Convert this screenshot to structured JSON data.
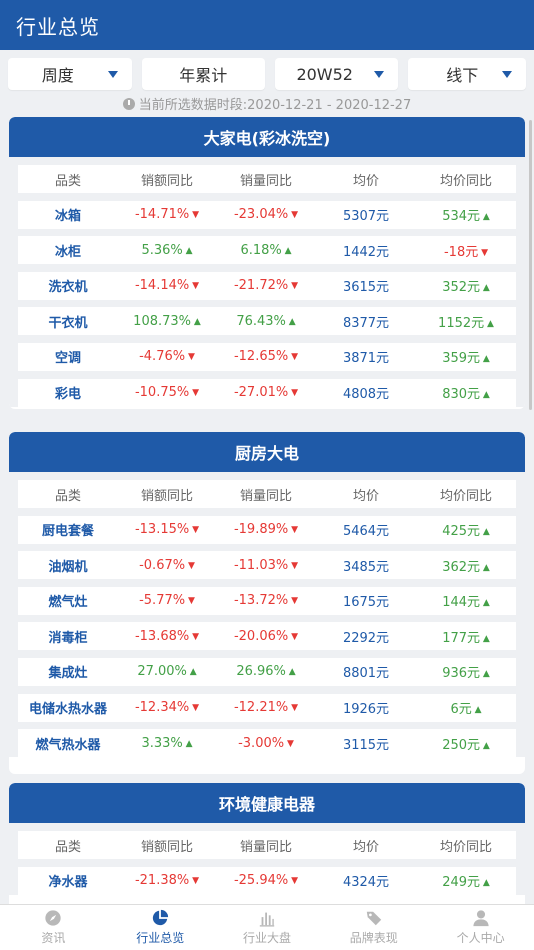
{
  "header": {
    "title": "行业总览"
  },
  "filters": [
    {
      "label": "周度",
      "has_dropdown": true
    },
    {
      "label": "年累计",
      "has_dropdown": false
    },
    {
      "label": "20W52",
      "has_dropdown": true
    },
    {
      "label": "线下",
      "has_dropdown": true
    }
  ],
  "period": {
    "text": "当前所选数据时段:2020-12-21 - 2020-12-27"
  },
  "columns": [
    "品类",
    "销额同比",
    "销量同比",
    "均价",
    "均价同比"
  ],
  "sections": [
    {
      "title": "大家电(彩冰洗空)",
      "rows": [
        {
          "name": "冰箱",
          "sales": "-14.71%",
          "volume": "-23.04%",
          "price": "5307元",
          "price_yoy": "534元"
        },
        {
          "name": "冰柜",
          "sales": "5.36%",
          "volume": "6.18%",
          "price": "1442元",
          "price_yoy": "-18元"
        },
        {
          "name": "洗衣机",
          "sales": "-14.14%",
          "volume": "-21.72%",
          "price": "3615元",
          "price_yoy": "352元"
        },
        {
          "name": "干衣机",
          "sales": "108.73%",
          "volume": "76.43%",
          "price": "8377元",
          "price_yoy": "1152元"
        },
        {
          "name": "空调",
          "sales": "-4.76%",
          "volume": "-12.65%",
          "price": "3871元",
          "price_yoy": "359元"
        },
        {
          "name": "彩电",
          "sales": "-10.75%",
          "volume": "-27.01%",
          "price": "4808元",
          "price_yoy": "830元"
        }
      ]
    },
    {
      "title": "厨房大电",
      "rows": [
        {
          "name": "厨电套餐",
          "sales": "-13.15%",
          "volume": "-19.89%",
          "price": "5464元",
          "price_yoy": "425元"
        },
        {
          "name": "油烟机",
          "sales": "-0.67%",
          "volume": "-11.03%",
          "price": "3485元",
          "price_yoy": "362元"
        },
        {
          "name": "燃气灶",
          "sales": "-5.77%",
          "volume": "-13.72%",
          "price": "1675元",
          "price_yoy": "144元"
        },
        {
          "name": "消毒柜",
          "sales": "-13.68%",
          "volume": "-20.06%",
          "price": "2292元",
          "price_yoy": "177元"
        },
        {
          "name": "集成灶",
          "sales": "27.00%",
          "volume": "26.96%",
          "price": "8801元",
          "price_yoy": "936元"
        },
        {
          "name": "电储水热水器",
          "sales": "-12.34%",
          "volume": "-12.21%",
          "price": "1926元",
          "price_yoy": "6元"
        },
        {
          "name": "燃气热水器",
          "sales": "3.33%",
          "volume": "-3.00%",
          "price": "3115元",
          "price_yoy": "250元"
        }
      ]
    },
    {
      "title": "环境健康电器",
      "rows": [
        {
          "name": "净水器",
          "sales": "-21.38%",
          "volume": "-25.94%",
          "price": "4324元",
          "price_yoy": "249元"
        }
      ]
    }
  ],
  "tabs": [
    {
      "label": "资讯",
      "icon": "compass-icon",
      "active": false
    },
    {
      "label": "行业总览",
      "icon": "pie-chart-icon",
      "active": true
    },
    {
      "label": "行业大盘",
      "icon": "bar-chart-icon",
      "active": false
    },
    {
      "label": "品牌表现",
      "icon": "tag-icon",
      "active": false
    },
    {
      "label": "个人中心",
      "icon": "user-icon",
      "active": false
    }
  ],
  "colors": {
    "primary": "#1f5aa8",
    "negative": "#e53935",
    "positive": "#43a047"
  }
}
